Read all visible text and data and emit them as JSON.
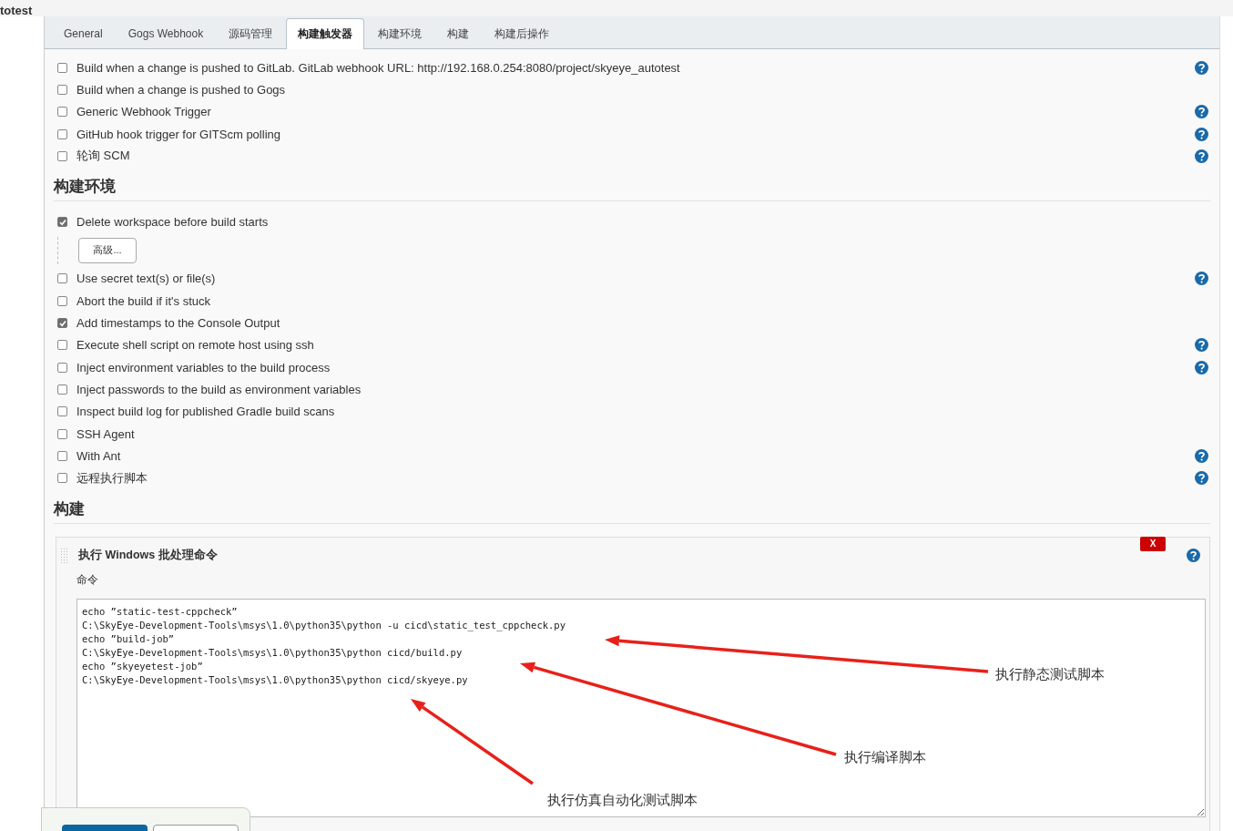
{
  "breadcrumb": "totest",
  "tabs": [
    {
      "label": "General",
      "selected": false
    },
    {
      "label": "Gogs Webhook",
      "selected": false
    },
    {
      "label": "源码管理",
      "selected": false
    },
    {
      "label": "构建触发器",
      "selected": true
    },
    {
      "label": "构建环境",
      "selected": false
    },
    {
      "label": "构建",
      "selected": false
    },
    {
      "label": "构建后操作",
      "selected": false
    }
  ],
  "trigger_options": [
    {
      "label": "Build when a change is pushed to GitLab. GitLab webhook URL: http://192.168.0.254:8080/project/skyeye_autotest",
      "checked": false,
      "help": true
    },
    {
      "label": "Build when a change is pushed to Gogs",
      "checked": false,
      "help": false
    },
    {
      "label": "Generic Webhook Trigger",
      "checked": false,
      "help": true
    },
    {
      "label": "GitHub hook trigger for GITScm polling",
      "checked": false,
      "help": true
    },
    {
      "label": "轮询 SCM",
      "checked": false,
      "help": true
    }
  ],
  "environment": {
    "heading": "构建环境",
    "options": [
      {
        "label": "Delete workspace before build starts",
        "checked": true,
        "help": false,
        "advanced_button": "高级..."
      },
      {
        "label": "Use secret text(s) or file(s)",
        "checked": false,
        "help": true
      },
      {
        "label": "Abort the build if it's stuck",
        "checked": false,
        "help": false
      },
      {
        "label": "Add timestamps to the Console Output",
        "checked": true,
        "help": false
      },
      {
        "label": "Execute shell script on remote host using ssh",
        "checked": false,
        "help": true
      },
      {
        "label": "Inject environment variables to the build process",
        "checked": false,
        "help": true
      },
      {
        "label": "Inject passwords to the build as environment variables",
        "checked": false,
        "help": false
      },
      {
        "label": "Inspect build log for published Gradle build scans",
        "checked": false,
        "help": false
      },
      {
        "label": "SSH Agent",
        "checked": false,
        "help": false
      },
      {
        "label": "With Ant",
        "checked": false,
        "help": true
      },
      {
        "label": "远程执行脚本",
        "checked": false,
        "help": true
      }
    ]
  },
  "build": {
    "heading": "构建",
    "step": {
      "title": "执行 Windows 批处理命令",
      "delete_label": "X",
      "field_label": "命令",
      "command": [
        "echo ”static-test-cppcheck”",
        "C:\\SkyEye-Development-Tools\\msys\\1.0\\python35\\python -u cicd\\static_test_cppcheck.py",
        "echo ”build-job”",
        "C:\\SkyEye-Development-Tools\\msys\\1.0\\python35\\python cicd/build.py",
        "echo ”skyeyetest-job”",
        "C:\\SkyEye-Development-Tools\\msys\\1.0\\python35\\python cicd/skyeye.py"
      ]
    }
  },
  "annotations": [
    "执行静态测试脚本",
    "执行编译脚本",
    "执行仿真自动化测试脚本"
  ]
}
